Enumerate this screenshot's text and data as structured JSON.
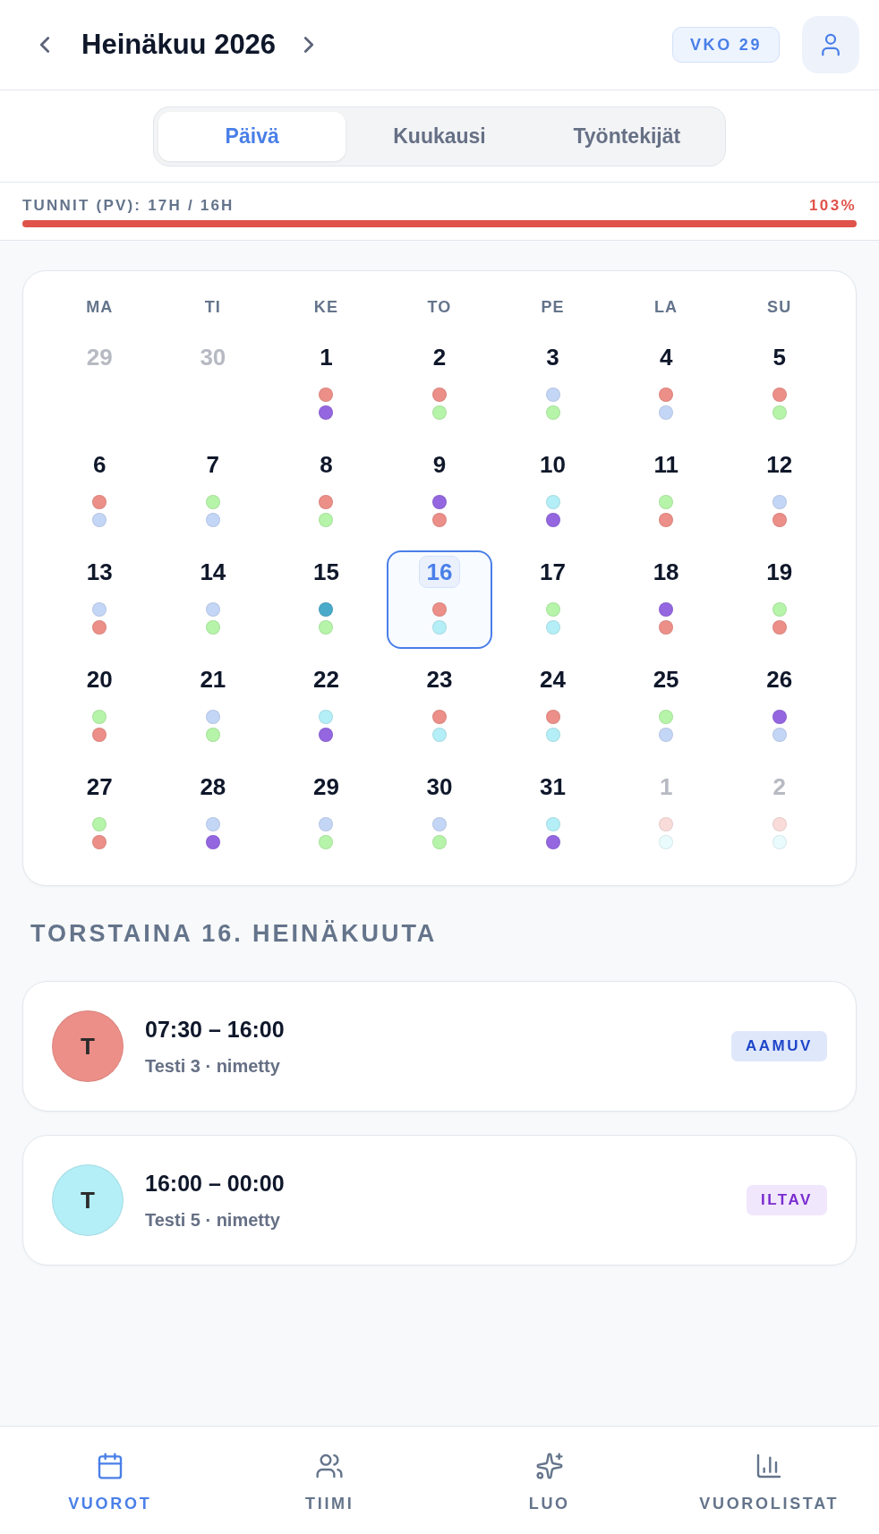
{
  "header": {
    "title": "Heinäkuu 2026",
    "week_badge": "VKO 29"
  },
  "view_tabs": [
    {
      "label": "Päivä",
      "selected": true
    },
    {
      "label": "Kuukausi",
      "selected": false
    },
    {
      "label": "Työntekijät",
      "selected": false
    }
  ],
  "hours": {
    "label": "TUNNIT (PV): 17H / 16H",
    "percent": "103%",
    "level": 1,
    "over": true
  },
  "calendar": {
    "weekdays": [
      "MA",
      "TI",
      "KE",
      "TO",
      "PE",
      "LA",
      "SU"
    ],
    "days": [
      {
        "date": "29",
        "outside_month": true,
        "selected": false
      },
      {
        "date": "30",
        "outside_month": true,
        "selected": false
      },
      {
        "date": "1",
        "outside_month": false,
        "selected": false,
        "dots": [
          {
            "color": "#ec8f88"
          },
          {
            "color": "#9467e0"
          }
        ]
      },
      {
        "date": "2",
        "outside_month": false,
        "selected": false,
        "dots": [
          {
            "color": "#ec8f88"
          },
          {
            "color": "#b6f4a9"
          }
        ]
      },
      {
        "date": "3",
        "outside_month": false,
        "selected": false,
        "dots": [
          {
            "color": "#c4d6f6"
          },
          {
            "color": "#b6f4a9"
          }
        ]
      },
      {
        "date": "4",
        "outside_month": false,
        "selected": false,
        "dots": [
          {
            "color": "#ec8f88"
          },
          {
            "color": "#c4d6f6"
          }
        ]
      },
      {
        "date": "5",
        "outside_month": false,
        "selected": false,
        "dots": [
          {
            "color": "#ec8f88"
          },
          {
            "color": "#b6f4a9"
          }
        ]
      },
      {
        "date": "6",
        "outside_month": false,
        "selected": false,
        "dots": [
          {
            "color": "#ec8f88"
          },
          {
            "color": "#c4d6f6"
          }
        ]
      },
      {
        "date": "7",
        "outside_month": false,
        "selected": false,
        "dots": [
          {
            "color": "#b6f4a9"
          },
          {
            "color": "#c4d6f6"
          }
        ]
      },
      {
        "date": "8",
        "outside_month": false,
        "selected": false,
        "dots": [
          {
            "color": "#ec8f88"
          },
          {
            "color": "#b6f4a9"
          }
        ]
      },
      {
        "date": "9",
        "outside_month": false,
        "selected": false,
        "dots": [
          {
            "color": "#9467e0"
          },
          {
            "color": "#ec8f88"
          }
        ]
      },
      {
        "date": "10",
        "outside_month": false,
        "selected": false,
        "dots": [
          {
            "color": "#b4eef6"
          },
          {
            "color": "#9467e0"
          }
        ]
      },
      {
        "date": "11",
        "outside_month": false,
        "selected": false,
        "dots": [
          {
            "color": "#b6f4a9"
          },
          {
            "color": "#ec8f88"
          }
        ]
      },
      {
        "date": "12",
        "outside_month": false,
        "selected": false,
        "dots": [
          {
            "color": "#c4d6f6"
          },
          {
            "color": "#ec8f88"
          }
        ]
      },
      {
        "date": "13",
        "outside_month": false,
        "selected": false,
        "dots": [
          {
            "color": "#c4d6f6"
          },
          {
            "color": "#ec8f88"
          }
        ]
      },
      {
        "date": "14",
        "outside_month": false,
        "selected": false,
        "dots": [
          {
            "color": "#c4d6f6"
          },
          {
            "color": "#b6f4a9"
          }
        ]
      },
      {
        "date": "15",
        "outside_month": false,
        "selected": false,
        "dots": [
          {
            "color": "#4aaac9"
          },
          {
            "color": "#b6f4a9"
          }
        ]
      },
      {
        "date": "16",
        "outside_month": false,
        "selected": true,
        "dots": [
          {
            "color": "#ec8f88"
          },
          {
            "color": "#b4eef6"
          }
        ]
      },
      {
        "date": "17",
        "outside_month": false,
        "selected": false,
        "dots": [
          {
            "color": "#b6f4a9"
          },
          {
            "color": "#b4eef6"
          }
        ]
      },
      {
        "date": "18",
        "outside_month": false,
        "selected": false,
        "dots": [
          {
            "color": "#9467e0"
          },
          {
            "color": "#ec8f88"
          }
        ]
      },
      {
        "date": "19",
        "outside_month": false,
        "selected": false,
        "dots": [
          {
            "color": "#b6f4a9"
          },
          {
            "color": "#ec8f88"
          }
        ]
      },
      {
        "date": "20",
        "outside_month": false,
        "selected": false,
        "dots": [
          {
            "color": "#b6f4a9"
          },
          {
            "color": "#ec8f88"
          }
        ]
      },
      {
        "date": "21",
        "outside_month": false,
        "selected": false,
        "dots": [
          {
            "color": "#c4d6f6"
          },
          {
            "color": "#b6f4a9"
          }
        ]
      },
      {
        "date": "22",
        "outside_month": false,
        "selected": false,
        "dots": [
          {
            "color": "#b4eef6"
          },
          {
            "color": "#9467e0"
          }
        ]
      },
      {
        "date": "23",
        "outside_month": false,
        "selected": false,
        "dots": [
          {
            "color": "#ec8f88"
          },
          {
            "color": "#b4eef6"
          }
        ]
      },
      {
        "date": "24",
        "outside_month": false,
        "selected": false,
        "dots": [
          {
            "color": "#ec8f88"
          },
          {
            "color": "#b4eef6"
          }
        ]
      },
      {
        "date": "25",
        "outside_month": false,
        "selected": false,
        "dots": [
          {
            "color": "#b6f4a9"
          },
          {
            "color": "#c4d6f6"
          }
        ]
      },
      {
        "date": "26",
        "outside_month": false,
        "selected": false,
        "dots": [
          {
            "color": "#9467e0"
          },
          {
            "color": "#c4d6f6"
          }
        ]
      },
      {
        "date": "27",
        "outside_month": false,
        "selected": false,
        "dots": [
          {
            "color": "#b6f4a9"
          },
          {
            "color": "#ec8f88"
          }
        ]
      },
      {
        "date": "28",
        "outside_month": false,
        "selected": false,
        "dots": [
          {
            "color": "#c4d6f6"
          },
          {
            "color": "#9467e0"
          }
        ]
      },
      {
        "date": "29",
        "outside_month": false,
        "selected": false,
        "dots": [
          {
            "color": "#c4d6f6"
          },
          {
            "color": "#b6f4a9"
          }
        ]
      },
      {
        "date": "30",
        "outside_month": false,
        "selected": false,
        "dots": [
          {
            "color": "#c4d6f6"
          },
          {
            "color": "#b6f4a9"
          }
        ]
      },
      {
        "date": "31",
        "outside_month": false,
        "selected": false,
        "dots": [
          {
            "color": "#b4eef6"
          },
          {
            "color": "#9467e0"
          }
        ]
      },
      {
        "date": "1",
        "outside_month": true,
        "selected": false,
        "dots": [
          {
            "color": "#f9dcd9"
          },
          {
            "color": "#e9fbfd"
          }
        ]
      },
      {
        "date": "2",
        "outside_month": true,
        "selected": false,
        "dots": [
          {
            "color": "#f9dcd9"
          },
          {
            "color": "#e9fbfd"
          }
        ]
      }
    ]
  },
  "day_title": "TORSTAINA 16. HEINÄKUUTA",
  "shifts": [
    {
      "initial": "T",
      "color": "#ec8f88",
      "time": "07:30 – 16:00",
      "detail": "Testi 3 · nimetty",
      "tag": {
        "label": "AAMUV",
        "kind": "morning"
      }
    },
    {
      "initial": "T",
      "color": "#b4eef6",
      "time": "16:00 – 00:00",
      "detail": "Testi 5 · nimetty",
      "tag": {
        "label": "ILTAV",
        "kind": "evening"
      }
    }
  ],
  "bottom_nav": [
    {
      "label": "VUOROT",
      "selected": true
    },
    {
      "label": "TIIMI",
      "selected": false
    },
    {
      "label": "LUO",
      "selected": false
    },
    {
      "label": "VUOROLISTAT",
      "selected": false
    }
  ]
}
